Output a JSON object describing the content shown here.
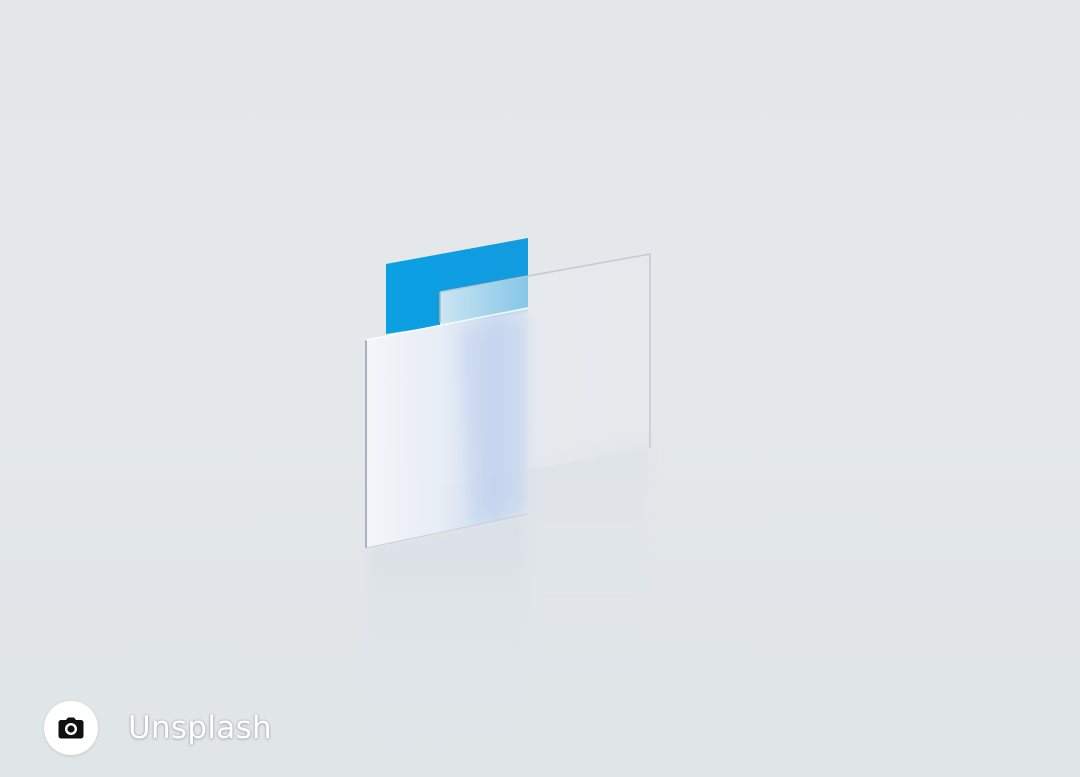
{
  "credit": {
    "label": "Unsplash",
    "icon": "camera-icon"
  },
  "colors": {
    "background": "#e3e7ea",
    "blue_panel": "#0ea1e0",
    "glass": "#f2f5f8",
    "badge": "#ffffff"
  }
}
